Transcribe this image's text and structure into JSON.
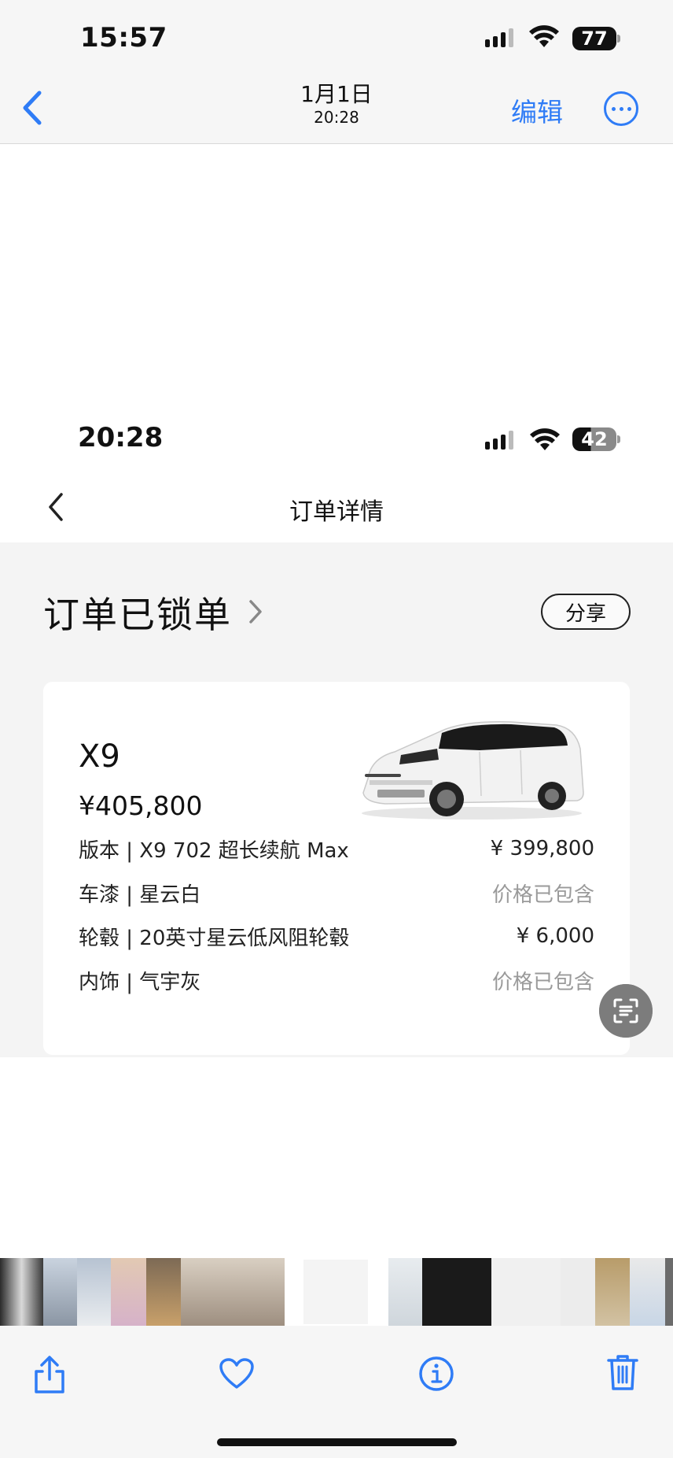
{
  "status_bar": {
    "time": "15:57",
    "battery": "77"
  },
  "photo_nav": {
    "date": "1月1日",
    "time": "20:28",
    "edit_label": "编辑"
  },
  "screenshot": {
    "status_bar": {
      "time": "20:28",
      "battery": "42"
    },
    "header": {
      "title": "订单详情"
    },
    "order": {
      "status": "订单已锁单",
      "share_label": "分享",
      "car": {
        "name": "X9",
        "price": "¥405,800"
      },
      "specs": [
        {
          "label": "版本 | X9 702 超长续航 Max",
          "value": "¥ 399,800"
        },
        {
          "label": "车漆 | 星云白",
          "value": "价格已包含"
        },
        {
          "label": "轮毂 | 20英寸星云低风阻轮毂",
          "value": "¥ 6,000"
        },
        {
          "label": "内饰 | 气宇灰",
          "value": "价格已包含"
        }
      ]
    }
  },
  "colors": {
    "accent": "#2f7cf6",
    "included_text": "#9a9a9a",
    "page_gray": "#f4f4f4"
  },
  "icons": [
    "signal-icon",
    "wifi-icon",
    "battery-icon",
    "back-chevron-icon",
    "more-icon",
    "chevron-right-icon",
    "text-scan-icon",
    "share-icon",
    "heart-icon",
    "info-icon",
    "trash-icon"
  ]
}
